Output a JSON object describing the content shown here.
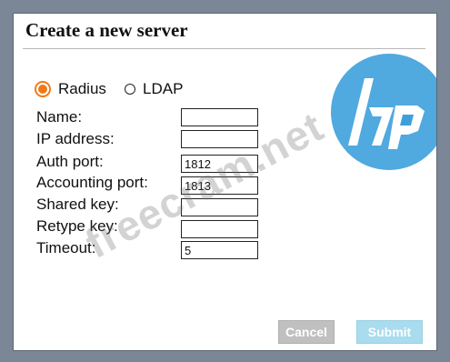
{
  "dialog": {
    "title": "Create a new server"
  },
  "server_type": {
    "options": [
      "Radius",
      "LDAP"
    ],
    "selected": "Radius"
  },
  "fields": [
    {
      "label": "Name:",
      "value": ""
    },
    {
      "label": "IP address:",
      "value": ""
    },
    {
      "label": "Auth port:",
      "value": "1812"
    },
    {
      "label": "Accounting port:",
      "value": "1813"
    },
    {
      "label": "Shared key:",
      "value": ""
    },
    {
      "label": "Retype key:",
      "value": ""
    },
    {
      "label": "Timeout:",
      "value": "5"
    }
  ],
  "buttons": {
    "cancel": "Cancel",
    "submit": "Submit"
  },
  "watermark": {
    "text": "freecram.net",
    "logo": "hp",
    "logo_color": "#3da0dc"
  },
  "colors": {
    "radio_selected": "#ef7a1a",
    "submit_bg": "#a8dcee",
    "cancel_bg": "#c0c0c0",
    "backdrop": "#7b8696"
  }
}
